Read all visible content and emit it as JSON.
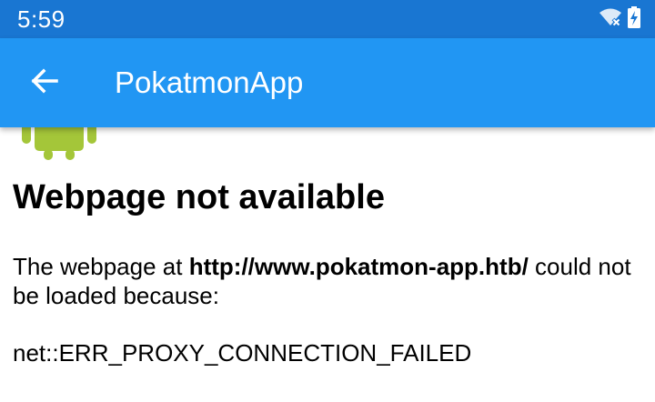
{
  "status_bar": {
    "time": "5:59",
    "icons": [
      "wifi-off-icon",
      "battery-charging-icon"
    ],
    "background_color": "#1976d2"
  },
  "app_bar": {
    "title": "PokatmonApp",
    "back_icon": "arrow-back-icon",
    "background_color": "#2196f3"
  },
  "error_page": {
    "icon": "android-mascot-icon",
    "heading": "Webpage not available",
    "message_prefix": "The webpage at ",
    "url": "http://www.pokatmon-app.htb/",
    "message_suffix": " could not be loaded because:",
    "error_code": "net::ERR_PROXY_CONNECTION_FAILED",
    "mascot_color": "#a4c639"
  }
}
